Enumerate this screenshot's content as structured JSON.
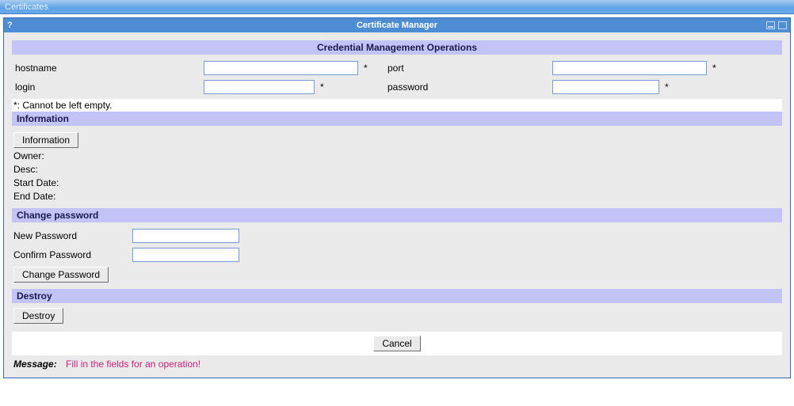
{
  "app": {
    "title": "Certificates"
  },
  "window": {
    "help": "?",
    "title": "Certificate Manager"
  },
  "headers": {
    "main": "Credential Management Operations",
    "information": "Information",
    "change_password": "Change password",
    "destroy": "Destroy"
  },
  "labels": {
    "hostname": "hostname",
    "port": "port",
    "login": "login",
    "password": "password",
    "star": "*",
    "required_note": "*: Cannot be left empty.",
    "new_password": "New Password",
    "confirm_password": "Confirm Password"
  },
  "info": {
    "owner_label": "Owner:",
    "owner_value": "",
    "desc_label": "Desc:",
    "desc_value": "",
    "start_label": "Start Date:",
    "start_value": "",
    "end_label": "End Date:",
    "end_value": ""
  },
  "buttons": {
    "information": "Information",
    "change_password": "Change Password",
    "destroy": "Destroy",
    "cancel": "Cancel"
  },
  "message": {
    "label": "Message:",
    "text": "Fill in the fields for an operation!"
  },
  "values": {
    "hostname": "",
    "port": "",
    "login": "",
    "password": "",
    "new_password": "",
    "confirm_password": ""
  }
}
